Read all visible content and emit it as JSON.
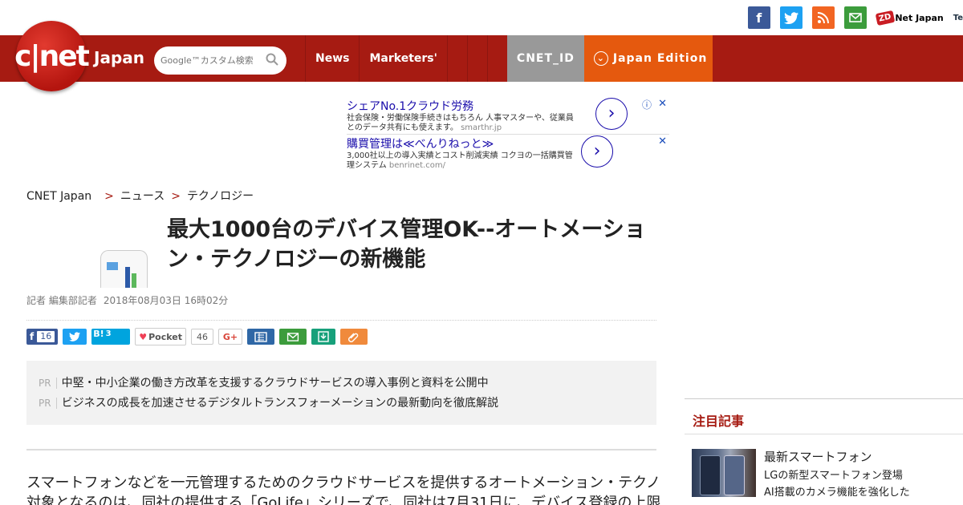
{
  "social": {
    "facebook": "f",
    "twitter": "t",
    "rss": "rss",
    "mail": "mail",
    "zdnet_badge": "ZD",
    "zdnet_label": "Net Japan",
    "te_label": "Te"
  },
  "header": {
    "logo_text": "c|net",
    "brand": "Japan",
    "search_placeholder": "Google™カスタム検索",
    "nav": [
      "News",
      "Marketers'"
    ],
    "cnet_id": "CNET_ID",
    "edition": "Japan Edition",
    "colors": {
      "nav_bg": "#a61b12",
      "edition_bg": "#e5590e",
      "cnet_id_bg": "#999999"
    }
  },
  "ads": [
    {
      "title": "シェアNo.1クラウド労務",
      "desc": "社会保険・労働保険手続きはもちろん 人事マスターや、従業員とのデータ共有にも使えます。",
      "url": "smarthr.jp"
    },
    {
      "title": "購買管理は≪べんりねっと≫",
      "desc": "3,000社以上の導入実績とコスト削減実績 コクヨの一括購買管理システム",
      "url": "benrinet.com/"
    }
  ],
  "breadcrumb": [
    "CNET Japan",
    "ニュース",
    "テクノロジー"
  ],
  "article": {
    "title": "最大1000台のデバイス管理OK--オートメーション・テクノロジーの新機能",
    "author": "記者 編集部記者",
    "date": "2018年08月03日 16時02分",
    "body_line1": "スマートフォンなどを一元管理するためのクラウドサービスを提供するオートメーション・テクノロジーは、同社のモバイルデバイス管理サービスについて新機能を発表した。",
    "body_line2": "対象となるのは、同社の提供する「GoLife」シリーズで、同社は7月31日に、デバイス登録の上限を引き上げたほか、iconの表示方法を変更した。"
  },
  "share": {
    "facebook_count": "16",
    "hatena": "B!",
    "hatena_count": "3",
    "pocket": "Pocket",
    "pocket_count": "46",
    "gplus": "G+"
  },
  "pr": [
    {
      "tag": "PR",
      "text": "中堅・中小企業の働き方改革を支援するクラウドサービスの導入事例と資料を公開中"
    },
    {
      "tag": "PR",
      "text": "ビジネスの成長を加速させるデジタルトランスフォーメーションの最新動向を徹底解説"
    }
  ],
  "sidebar": {
    "title": "注目記事",
    "item_headline": "最新スマートフォン",
    "item_line1": "LGの新型スマートフォン登場",
    "item_line2": "AI搭載のカメラ機能を強化した"
  }
}
